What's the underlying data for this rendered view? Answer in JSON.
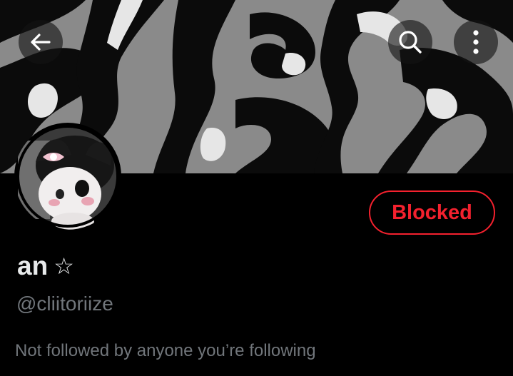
{
  "header": {
    "back_icon": "arrow-left-icon",
    "search_icon": "search-icon",
    "more_icon": "more-vertical-icon"
  },
  "profile": {
    "display_name": "an",
    "name_symbol": "☆",
    "handle": "@cliitoriize",
    "follow_context": "Not followed by anyone you’re following"
  },
  "actions": {
    "blocked_label": "Blocked"
  },
  "colors": {
    "background": "#000000",
    "blocked_red": "#f4212e",
    "primary_text": "#e7e9ea",
    "secondary_text": "#71767b"
  }
}
